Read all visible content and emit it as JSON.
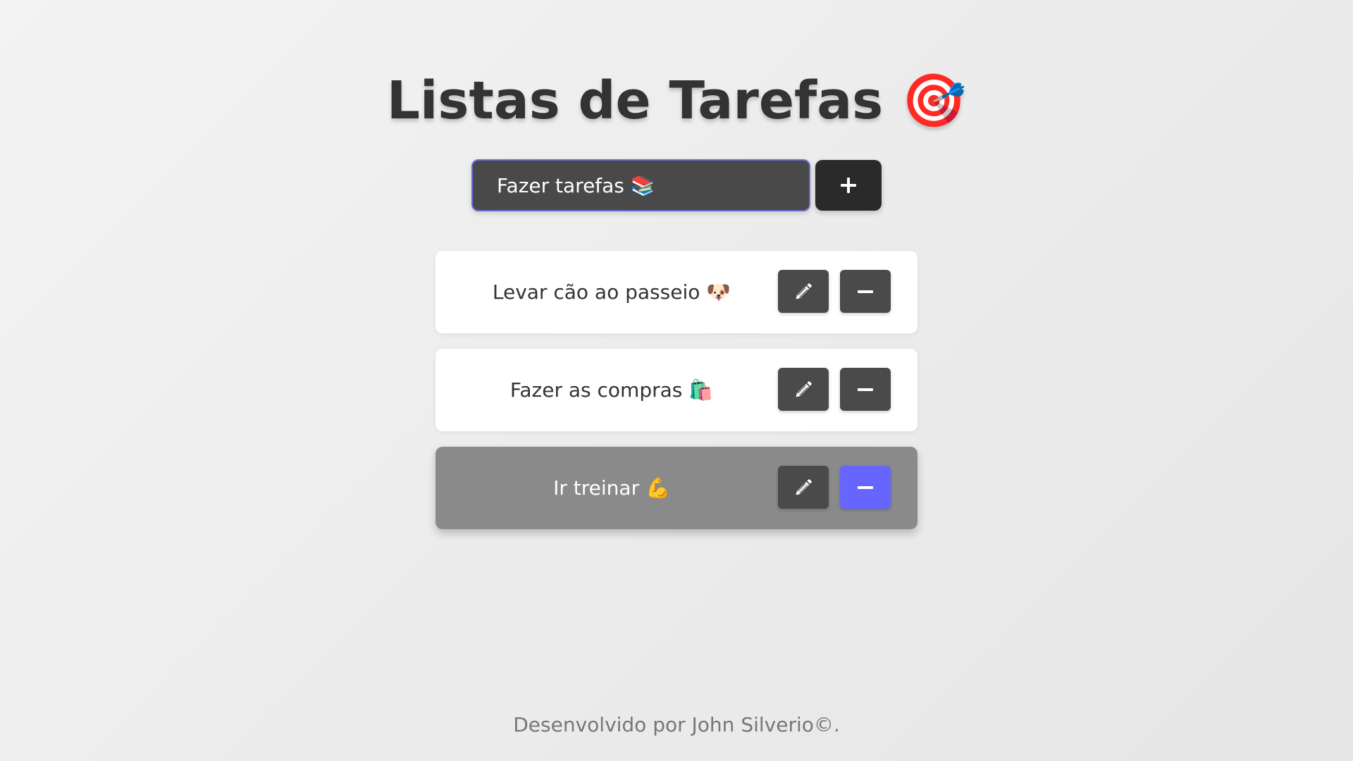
{
  "app": {
    "title": "Listas de Tarefas",
    "title_emoji": "🎯"
  },
  "form": {
    "input_value": "Fazer tarefas 📚",
    "add_icon": "plus-icon"
  },
  "tasks": [
    {
      "text": "Levar cão ao passeio 🐶",
      "edit_icon": "pencil-icon",
      "remove_icon": "minus-icon",
      "highlighted": false
    },
    {
      "text": "Fazer as compras 🛍️",
      "edit_icon": "pencil-icon",
      "remove_icon": "minus-icon",
      "highlighted": false
    },
    {
      "text": "Ir treinar 💪",
      "edit_icon": "pencil-icon",
      "remove_icon": "minus-icon",
      "highlighted": true
    }
  ],
  "footer": {
    "text": "Desenvolvido por John Silverio©."
  },
  "colors": {
    "accent": "#6666ff",
    "dark_button": "#4a4a4a",
    "input_bg": "#494949",
    "highlight_row": "#8a8a8a"
  }
}
